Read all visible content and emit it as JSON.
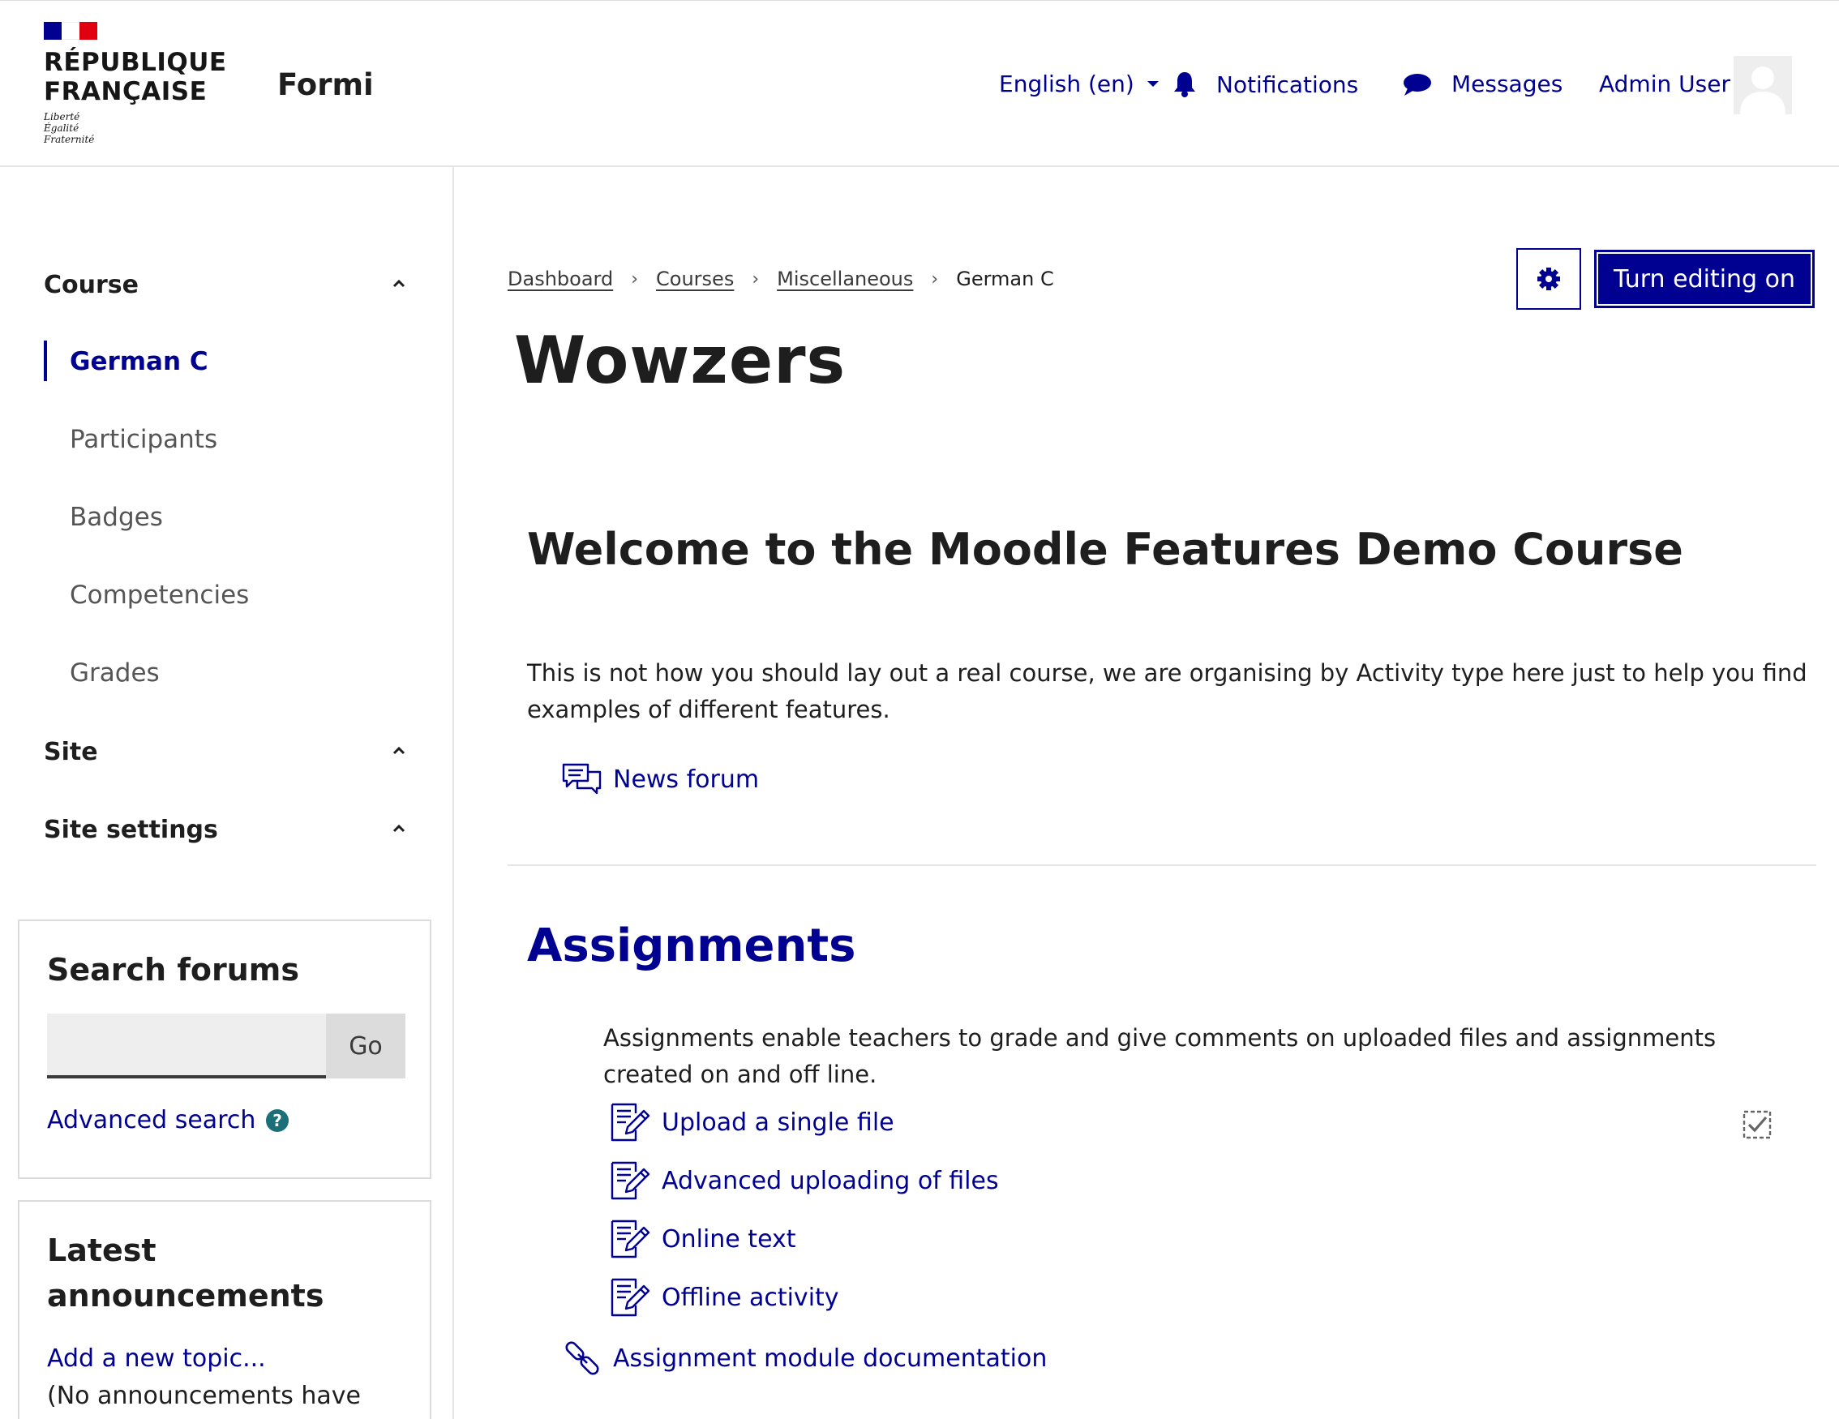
{
  "header": {
    "logo_line1": "RÉPUBLIQUE",
    "logo_line2": "FRANÇAISE",
    "motto": [
      "Liberté",
      "Égalité",
      "Fraternité"
    ],
    "site_name": "Formi",
    "language": "English (en)",
    "notifications_label": "Notifications",
    "messages_label": "Messages",
    "user_name": "Admin User"
  },
  "sidebar": {
    "course_section": "Course",
    "course_items": [
      {
        "label": "German C",
        "active": true
      },
      {
        "label": "Participants"
      },
      {
        "label": "Badges"
      },
      {
        "label": "Competencies"
      },
      {
        "label": "Grades"
      }
    ],
    "site_section": "Site",
    "site_settings_section": "Site settings",
    "search_block": {
      "title": "Search forums",
      "input_value": "",
      "go_label": "Go",
      "advanced_link": "Advanced search"
    },
    "announcements_block": {
      "title_line1": "Latest",
      "title_line2": "announcements",
      "add_link": "Add a new topic...",
      "empty_text": "(No announcements have"
    }
  },
  "breadcrumb": [
    "Dashboard",
    "Courses",
    "Miscellaneous",
    "German C"
  ],
  "buttons": {
    "editing": "Turn editing on"
  },
  "page_title": "Wowzers",
  "intro": {
    "heading": "Welcome to the Moodle Features Demo Course",
    "text_line1": "This is not how you should lay out a real course, we are organising by Activity type here just to help you find",
    "text_line2": "examples of different features.",
    "news_forum": "News forum"
  },
  "assignments": {
    "heading": "Assignments",
    "desc_line1": "Assignments enable teachers to grade and give comments on uploaded files and assignments",
    "desc_line2": "created on and off line.",
    "items": [
      "Upload a single file",
      "Advanced uploading of files",
      "Online text",
      "Offline activity"
    ],
    "doc_link": "Assignment module documentation"
  },
  "colors": {
    "primary": "#000091",
    "text": "#1e1e1e",
    "muted": "#555555",
    "flag_blue": "#000091",
    "flag_red": "#e1000f",
    "help_icon": "#1a6f78"
  }
}
